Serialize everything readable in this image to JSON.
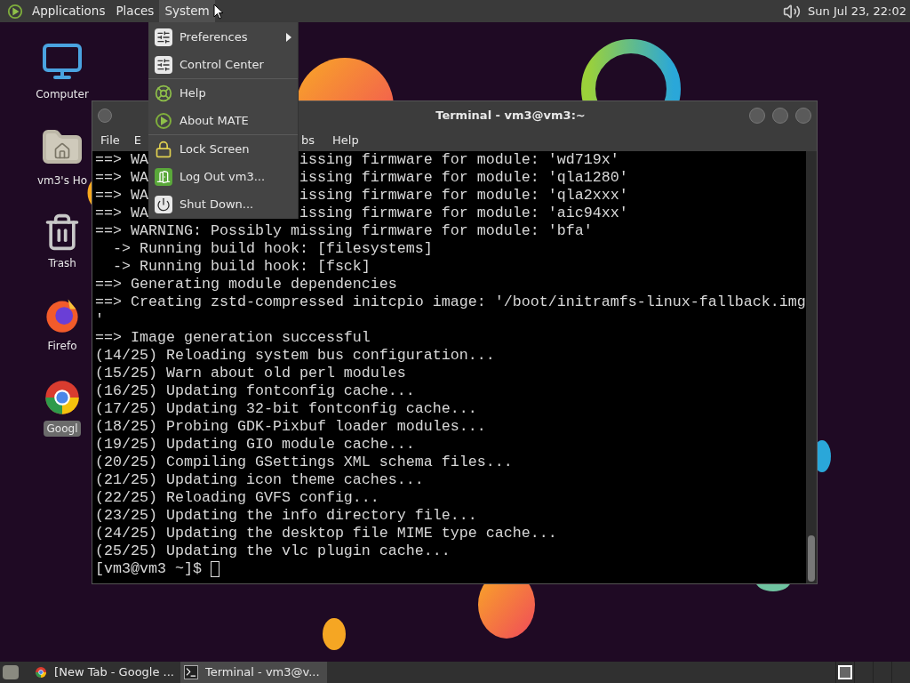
{
  "top_panel": {
    "menus": [
      {
        "label": "Applications",
        "selected": false
      },
      {
        "label": "Places",
        "selected": false
      },
      {
        "label": "System",
        "selected": true
      }
    ],
    "clock": "Sun Jul 23, 22:02"
  },
  "desktop_icons": [
    {
      "label": "Computer",
      "kind": "computer",
      "selected": false
    },
    {
      "label": "vm3's Ho",
      "kind": "home",
      "selected": false
    },
    {
      "label": "Trash",
      "kind": "trash",
      "selected": false
    },
    {
      "label": "Firefo",
      "kind": "firefox",
      "selected": false
    },
    {
      "label": "Googl",
      "kind": "chrome",
      "selected": true
    }
  ],
  "terminal": {
    "title": "Terminal - vm3@vm3:~",
    "menu": [
      "File",
      "E",
      "bs",
      "Help"
    ],
    "lines": [
      {
        "text": "==> WA",
        "after": "issing firmware for module: 'wd719x'"
      },
      {
        "text": "==> WA",
        "after": "issing firmware for module: 'qla1280'"
      },
      {
        "text": "==> WA",
        "after": "issing firmware for module: 'qla2xxx'"
      },
      {
        "text": "==> WA",
        "after": "issing firmware for module: 'aic94xx'"
      },
      {
        "text": "==> WARNING: Possibly missing firmware for module: 'bfa'"
      },
      {
        "text": "  -> Running build hook: [filesystems]"
      },
      {
        "text": "  -> Running build hook: [fsck]"
      },
      {
        "text": "==> Generating module dependencies"
      },
      {
        "text": "==> Creating zstd-compressed initcpio image: '/boot/initramfs-linux-fallback.img"
      },
      {
        "text": "'"
      },
      {
        "text": "==> Image generation successful"
      },
      {
        "text": "(14/25) Reloading system bus configuration..."
      },
      {
        "text": "(15/25) Warn about old perl modules"
      },
      {
        "text": "(16/25) Updating fontconfig cache..."
      },
      {
        "text": "(17/25) Updating 32-bit fontconfig cache..."
      },
      {
        "text": "(18/25) Probing GDK-Pixbuf loader modules..."
      },
      {
        "text": "(19/25) Updating GIO module cache..."
      },
      {
        "text": "(20/25) Compiling GSettings XML schema files..."
      },
      {
        "text": "(21/25) Updating icon theme caches..."
      },
      {
        "text": "(22/25) Reloading GVFS config..."
      },
      {
        "text": "(23/25) Updating the info directory file..."
      },
      {
        "text": "(24/25) Updating the desktop file MIME type cache..."
      },
      {
        "text": "(25/25) Updating the vlc plugin cache..."
      }
    ],
    "prompt": "[vm3@vm3 ~]$"
  },
  "system_menu": {
    "groups": [
      [
        {
          "label": "Preferences",
          "kind": "sliders",
          "submenu": true
        },
        {
          "label": "Control Center",
          "kind": "sliders",
          "submenu": false
        }
      ],
      [
        {
          "label": "Help",
          "kind": "help",
          "submenu": false
        },
        {
          "label": "About MATE",
          "kind": "mate",
          "submenu": false
        }
      ],
      [
        {
          "label": "Lock Screen",
          "kind": "lock",
          "submenu": false
        },
        {
          "label": "Log Out vm3...",
          "kind": "logout",
          "submenu": false
        },
        {
          "label": "Shut Down...",
          "kind": "power",
          "submenu": false
        }
      ]
    ]
  },
  "taskbar": {
    "tasks": [
      {
        "label": "[New Tab - Google ...",
        "kind": "chrome",
        "selected": false
      },
      {
        "label": "Terminal - vm3@v...",
        "kind": "terminal",
        "selected": true
      }
    ],
    "workspaces": [
      {
        "selected": true
      },
      {
        "selected": false
      },
      {
        "selected": false
      },
      {
        "selected": false
      }
    ]
  }
}
